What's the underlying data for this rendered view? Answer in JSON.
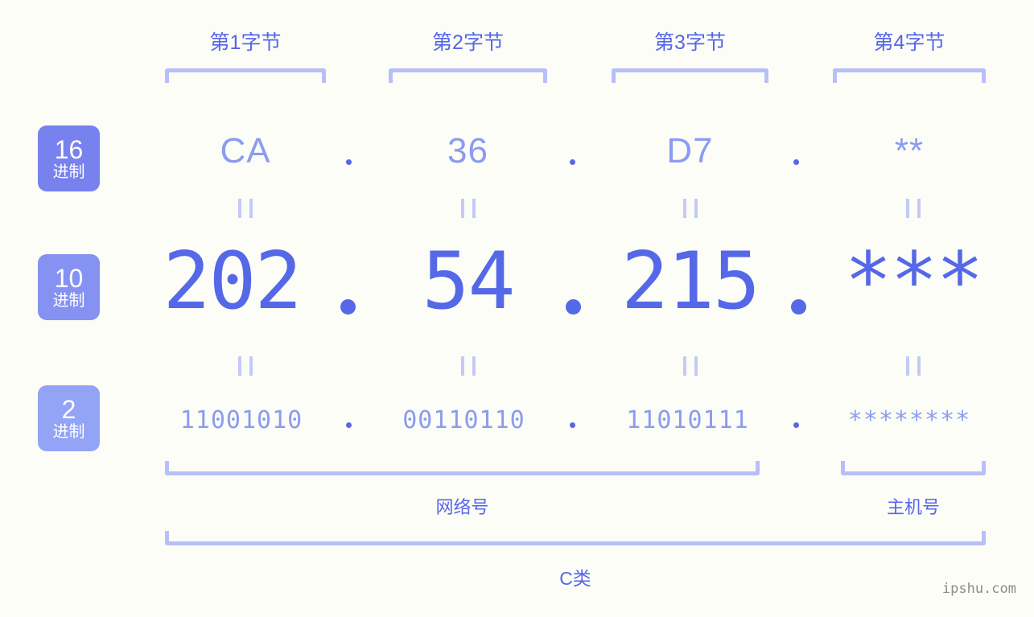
{
  "watermark": "ipshu.com",
  "byte_headers": [
    {
      "label": "第1字节"
    },
    {
      "label": "第2字节"
    },
    {
      "label": "第3字节"
    },
    {
      "label": "第4字节"
    }
  ],
  "bases": [
    {
      "num": "16",
      "sub": "进制",
      "color": "#7782ee"
    },
    {
      "num": "10",
      "sub": "进制",
      "color": "#8692f2"
    },
    {
      "num": "2",
      "sub": "进制",
      "color": "#93a3f5"
    }
  ],
  "rows": {
    "hex": {
      "name": "16进制",
      "values": [
        "CA",
        "36",
        "D7",
        "**"
      ]
    },
    "decimal": {
      "name": "10进制",
      "values": [
        "202",
        "54",
        "215",
        "***"
      ]
    },
    "binary": {
      "name": "2进制",
      "values": [
        "11001010",
        "00110110",
        "11010111",
        "********"
      ]
    }
  },
  "separator": ".",
  "equals_mark": "=",
  "footer": {
    "network_label": "网络号",
    "host_label": "主机号",
    "class_label": "C类"
  },
  "colors": {
    "background": "#fcfdf7",
    "accent_strong": "#5568e8",
    "accent_light": "#8b9cf0",
    "bracket": "#b7bffa",
    "badge_16": "#7782ee",
    "badge_10": "#8692f2",
    "badge_2": "#93a3f5",
    "watermark": "#8c8c8c"
  }
}
